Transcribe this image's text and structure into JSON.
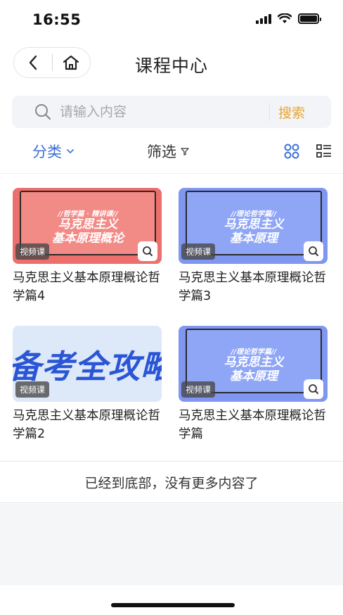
{
  "status_bar": {
    "time": "16:55"
  },
  "nav": {
    "title": "课程中心",
    "back_icon": "chevron-left-icon",
    "home_icon": "home-icon"
  },
  "search": {
    "placeholder": "请输入内容",
    "button_label": "搜索"
  },
  "filters": {
    "category_label": "分类",
    "filter_label": "筛选",
    "accent_color": "#3b6fd8"
  },
  "courses": [
    {
      "title": "马克思主义基本原理概论哲学篇4",
      "badge": "视频课",
      "cover_top": "//哲学篇 · 精讲课//",
      "cover_main_1": "马克思主义",
      "cover_main_2": "基本原理概论",
      "theme": "red"
    },
    {
      "title": "马克思主义基本原理概论哲学篇3",
      "badge": "视频课",
      "cover_top": "//理论哲学篇//",
      "cover_main_1": "马克思主义",
      "cover_main_2": "基本原理",
      "theme": "blue"
    },
    {
      "title": "马克思主义基本原理概论哲学篇2",
      "badge": "视频课",
      "cover_big": "备考全攻略",
      "theme": "light"
    },
    {
      "title": "马克思主义基本原理概论哲学篇",
      "badge": "视频课",
      "cover_top": "//理论哲学篇//",
      "cover_main_1": "马克思主义",
      "cover_main_2": "基本原理",
      "theme": "blue"
    }
  ],
  "footer": {
    "end_text": "已经到底部，没有更多内容了"
  }
}
